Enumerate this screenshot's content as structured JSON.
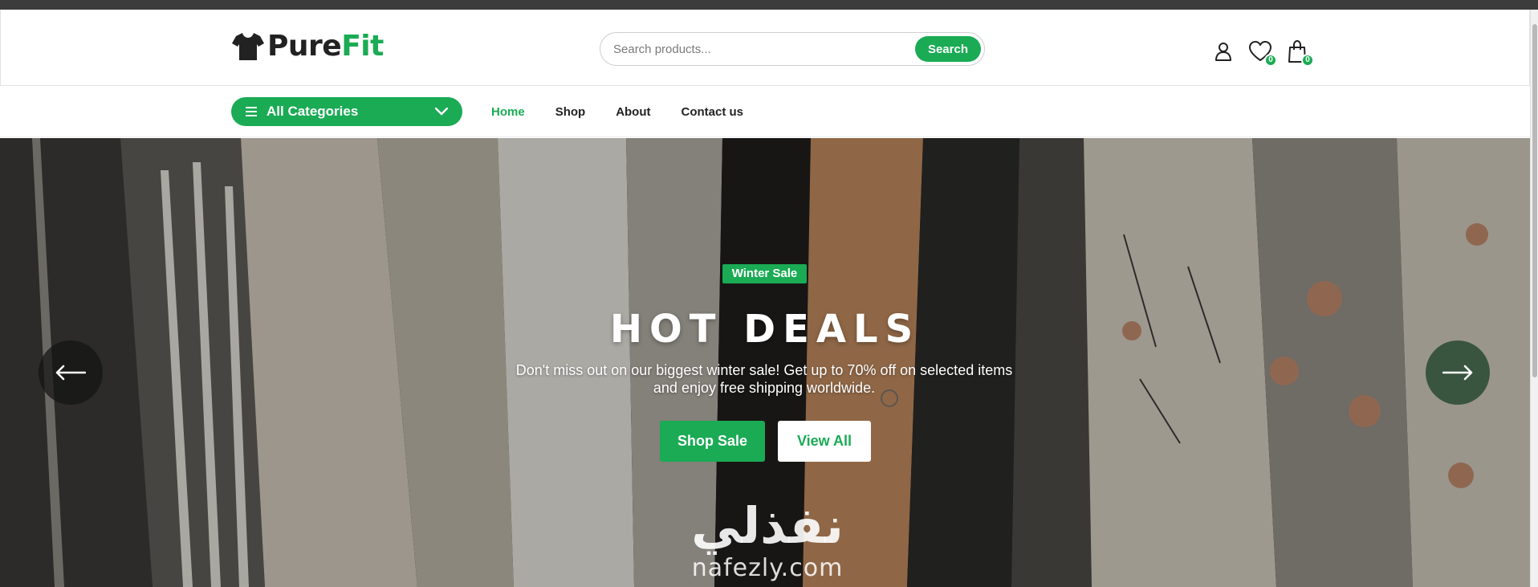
{
  "header": {
    "logo": {
      "part1": "Pure",
      "part2": "Fit"
    },
    "search": {
      "placeholder": "Search products...",
      "button_label": "Search"
    },
    "icons": {
      "account": "user-icon",
      "wishlist": {
        "icon": "heart-icon",
        "count": "0"
      },
      "cart": {
        "icon": "shopping-bag-icon",
        "count": "0"
      }
    }
  },
  "nav": {
    "categories_label": "All Categories",
    "links": [
      {
        "label": "Home",
        "active": true
      },
      {
        "label": "Shop",
        "active": false
      },
      {
        "label": "About",
        "active": false
      },
      {
        "label": "Contact us",
        "active": false
      }
    ]
  },
  "hero": {
    "tag": "Winter Sale",
    "title": "HOT DEALS",
    "description": "Don't miss out on our biggest winter sale! Get up to 70% off on selected items and enjoy free shipping worldwide.",
    "primary_button": "Shop Sale",
    "secondary_button": "View All",
    "prev_arrow": "arrow-left-icon",
    "next_arrow": "arrow-right-icon"
  },
  "watermark": {
    "arabic": "نفذلي",
    "latin": "nafezly.com"
  },
  "colors": {
    "brand_green": "#1aab54",
    "dark": "#222222",
    "top_strip": "#3c3c3c"
  }
}
